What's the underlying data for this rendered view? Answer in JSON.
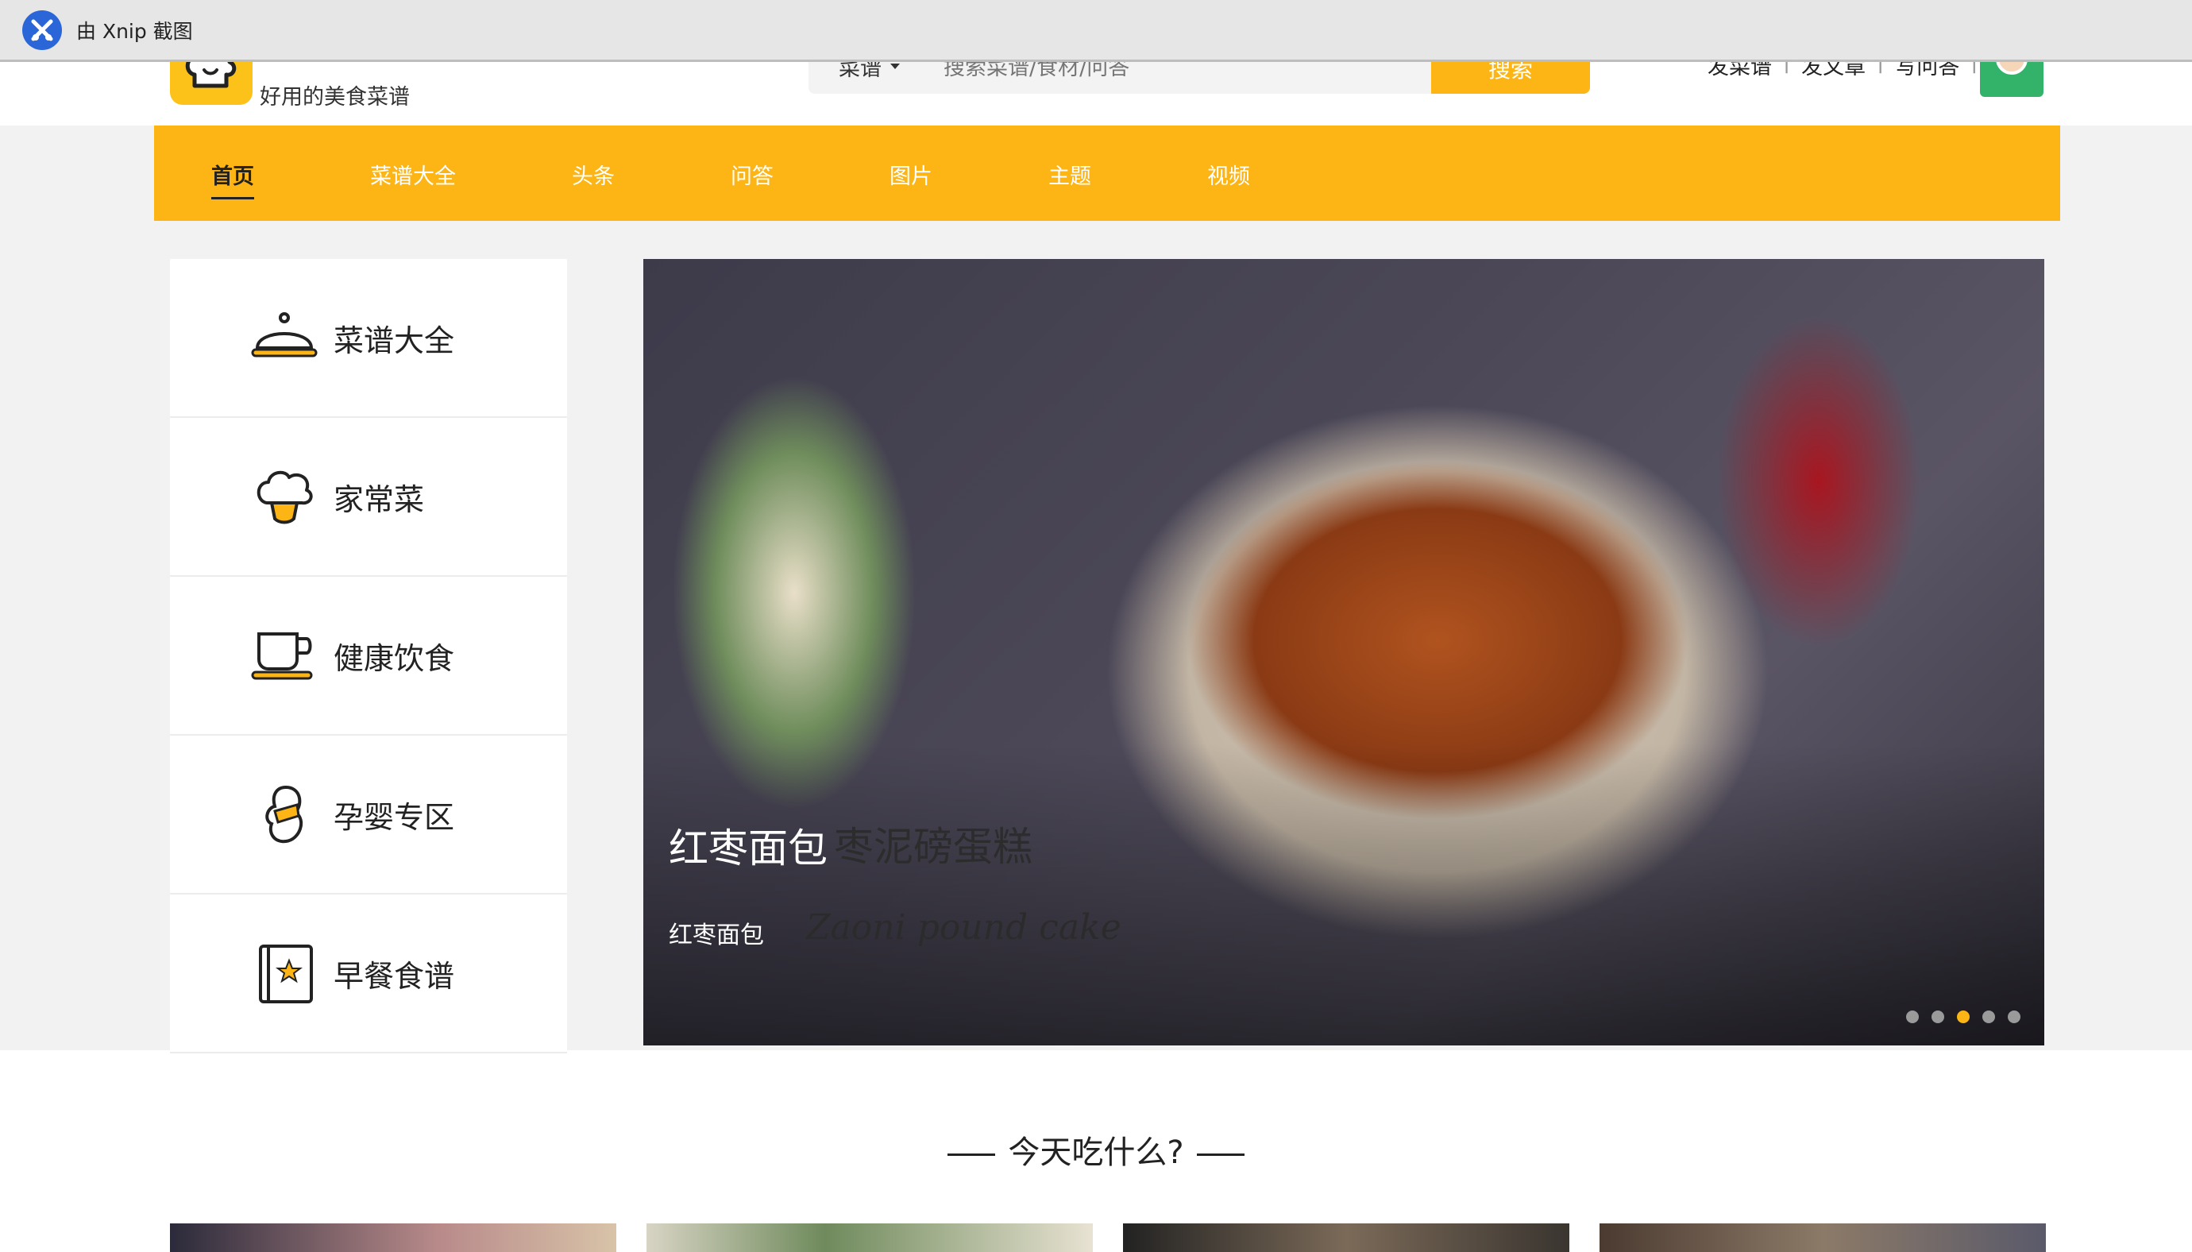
{
  "xnip": {
    "text": "由 Xnip 截图"
  },
  "header": {
    "logo_title": "",
    "logo_subtitle": "好用的美食菜谱",
    "search_type": "菜谱",
    "search_placeholder": "搜索菜谱/食材/问答",
    "search_button": "搜索",
    "user_links": [
      "发菜谱",
      "发文章",
      "写问答"
    ]
  },
  "nav": {
    "items": [
      "首页",
      "菜谱大全",
      "头条",
      "问答",
      "图片",
      "主题",
      "视频"
    ],
    "active_index": 0
  },
  "sidebar": {
    "categories": [
      "菜谱大全",
      "家常菜",
      "健康饮食",
      "孕婴专区",
      "早餐食谱"
    ]
  },
  "hero": {
    "title": "红枣面包",
    "subtitle": "红枣面包",
    "overlay_text_cn": "枣泥磅蛋糕",
    "overlay_text_en": "Zaoni pound cake",
    "dot_count": 5,
    "active_dot": 2
  },
  "section": {
    "title": "今天吃什么?"
  },
  "colors": {
    "brand_yellow": "#fcb514",
    "nav_active": "#222222",
    "sidebar_bg": "#ffffff",
    "page_bg": "#f2f2f2"
  }
}
